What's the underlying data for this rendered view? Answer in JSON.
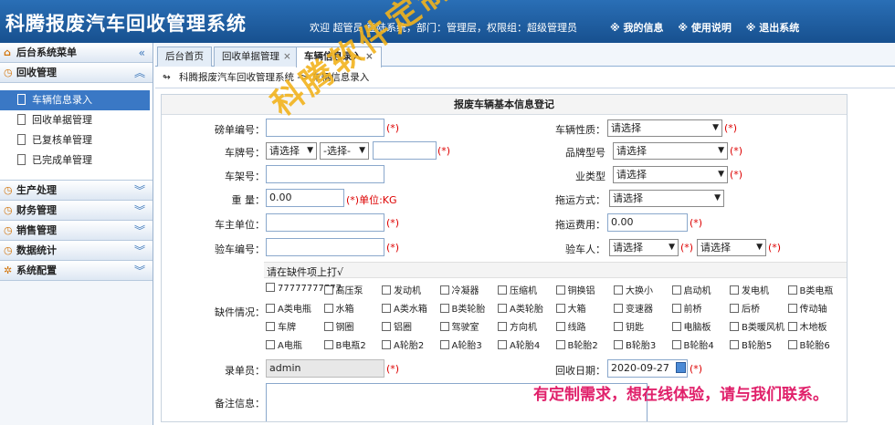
{
  "header": {
    "title": "科腾报废汽车回收管理系统",
    "welcome": "欢迎 超管员 登陆系统，部门：管理层，权限组：超级管理员",
    "links": [
      "※ 我的信息",
      "※ 使用说明",
      "※ 退出系统"
    ]
  },
  "sidebar": {
    "title": "后台系统菜单",
    "groups": [
      {
        "label": "回收管理",
        "items": [
          "车辆信息录入",
          "回收单据管理",
          "已复核单管理",
          "已完成单管理"
        ]
      },
      {
        "label": "生产处理"
      },
      {
        "label": "财务管理"
      },
      {
        "label": "销售管理"
      },
      {
        "label": "数据统计"
      },
      {
        "label": "系统配置"
      }
    ]
  },
  "tabs": [
    "后台首页",
    "回收单据管理",
    "车辆信息录入"
  ],
  "breadcrumb": "科腾报废汽车回收管理系统 -> 车辆信息录入",
  "form": {
    "title": "报废车辆基本信息登记",
    "bangdan_label": "磅单编号：",
    "vehicle_type_label": "车辆性质：",
    "vehicle_type_value": "请选择",
    "plate_label": "车牌号：",
    "plate_sel1": "请选择",
    "plate_sel2": "-选择-",
    "brand_label": "品牌型号",
    "brand_value": "请选择",
    "frame_label": "车架号：",
    "engine_label": "业类型",
    "engine_value": "请选择",
    "weight_label": "重 量：",
    "weight_value": "0.00",
    "weight_hint": "(*)单位:KG",
    "tow_label": "拖运方式：",
    "tow_value": "请选择",
    "owner_label": "车主单位：",
    "towfee_label": "拖运费用：",
    "towfee_value": "0.00",
    "inspect_no_label": "验车编号：",
    "inspector_label": "验车人：",
    "inspector_value1": "请选择",
    "inspector_value2": "请选择",
    "missing_label": "缺件情况：",
    "missing_hint": "请在缺件项上打√",
    "missing_items": [
      [
        "77777777777",
        "高压泵",
        "发动机",
        "冷凝器",
        "压缩机",
        "铜换铝",
        "大换小",
        "启动机",
        "发电机",
        "B类电瓶"
      ],
      [
        "A类电瓶",
        "水箱",
        "A类水箱",
        "B类轮胎",
        "A类轮胎",
        "大箱",
        "变速器",
        "前桥",
        "后桥",
        "传动轴"
      ],
      [
        "车牌",
        "钢圈",
        "铝圈",
        "驾驶室",
        "方向机",
        "线路",
        "钥匙",
        "电脑板",
        "B类暖风机",
        "木地板"
      ],
      [
        "A电瓶",
        "B电瓶2",
        "A轮胎2",
        "A轮胎3",
        "A轮胎4",
        "B轮胎2",
        "B轮胎3",
        "B轮胎4",
        "B轮胎5",
        "B轮胎6"
      ]
    ],
    "recorder_label": "录单员：",
    "recorder_value": "admin",
    "date_label": "回收日期：",
    "date_value": "2020-09-27",
    "note_label": "备注信息：",
    "req": "(*)"
  },
  "watermark": "科腾软件定制开发项目之一",
  "watermark2": "有定制需求，想在线体验，请与我们联系。"
}
